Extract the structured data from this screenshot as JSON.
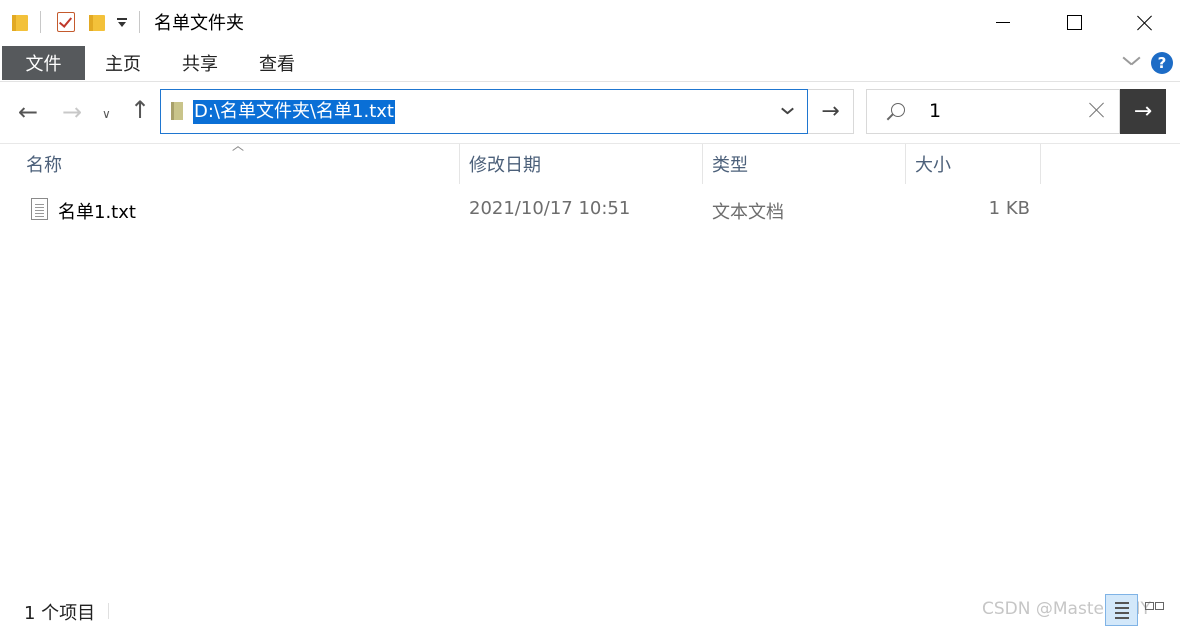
{
  "window": {
    "title": "名单文件夹"
  },
  "ribbon": {
    "tabs": [
      {
        "label": "文件"
      },
      {
        "label": "主页"
      },
      {
        "label": "共享"
      },
      {
        "label": "查看"
      }
    ],
    "help_label": "?"
  },
  "address_bar": {
    "path": "D:\\名单文件夹\\名单1.txt"
  },
  "search": {
    "value": "1"
  },
  "columns": [
    {
      "label": "名称"
    },
    {
      "label": "修改日期"
    },
    {
      "label": "类型"
    },
    {
      "label": "大小"
    }
  ],
  "files": [
    {
      "name": "名单1.txt",
      "modified": "2021/10/17 10:51",
      "type": "文本文档",
      "size": "1 KB",
      "icon": "text-file-icon"
    }
  ],
  "status_bar": {
    "item_count": "1 个项目",
    "watermark": "CSDN @MasterWHY"
  },
  "colors": {
    "file_tab_bg": "#56595c",
    "selection_bg": "#0a6fd6",
    "address_border": "#1f76d0",
    "help_icon_bg": "#1d6cc6",
    "column_header_text": "#4c607a"
  }
}
